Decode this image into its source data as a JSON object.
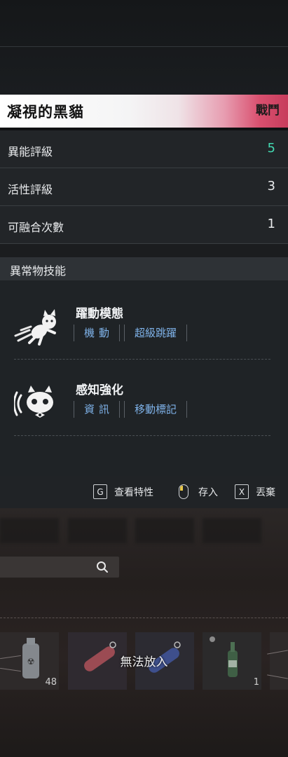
{
  "item": {
    "name": "凝視的黑貓",
    "type": "戰鬥"
  },
  "stats": [
    {
      "label": "異能評級",
      "value": "5",
      "highlight": true
    },
    {
      "label": "活性評級",
      "value": "3",
      "highlight": false
    },
    {
      "label": "可融合次數",
      "value": "1",
      "highlight": false
    }
  ],
  "skills_section": {
    "title": "異常物技能",
    "skills": [
      {
        "name": "躍動模態",
        "icon": "running-cat-icon",
        "tags": [
          "機動",
          "超級跳躍"
        ]
      },
      {
        "name": "感知強化",
        "icon": "sensing-cat-icon",
        "tags": [
          "資訊",
          "移動標記"
        ]
      }
    ]
  },
  "actions": [
    {
      "key": "G",
      "label": "查看特性"
    },
    {
      "key": "mouse-left",
      "label": "存入"
    },
    {
      "key": "X",
      "label": "丟棄"
    }
  ],
  "inventory": {
    "overlay_text": "無法放入",
    "slots": [
      {
        "icon": "canister-icon",
        "count": "48"
      },
      {
        "icon": "red-capsule-icon",
        "count": ""
      },
      {
        "icon": "blue-capsule-icon",
        "count": ""
      },
      {
        "icon": "green-bottle-icon",
        "count": "1"
      }
    ]
  },
  "colors": {
    "accent_green": "#43d9b1",
    "tag_blue": "#7fb3ea",
    "header_pink": "#c73c5c"
  }
}
